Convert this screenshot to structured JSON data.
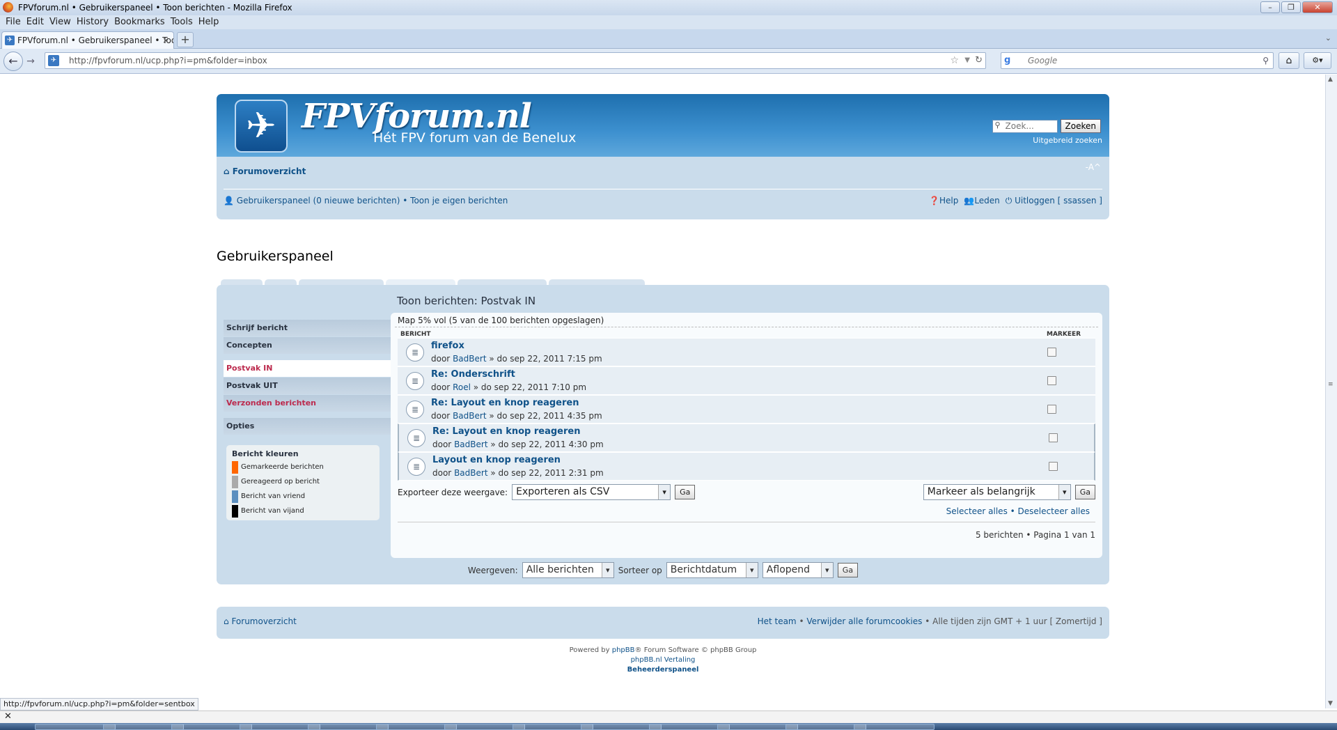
{
  "browser": {
    "window_title": "FPVforum.nl • Gebruikerspaneel • Toon berichten - Mozilla Firefox",
    "menu": [
      "File",
      "Edit",
      "View",
      "History",
      "Bookmarks",
      "Tools",
      "Help"
    ],
    "tab_title": "FPVforum.nl • Gebruikerspaneel • Toon ...",
    "url": "http://fpvforum.nl/ucp.php?i=pm&folder=inbox",
    "search_placeholder": "Google",
    "status_url": "http://fpvforum.nl/ucp.php?i=pm&folder=sentbox"
  },
  "site": {
    "title": "FPVforum.nl",
    "subtitle": "Hét FPV forum van de Benelux",
    "search_placeholder": "Zoek...",
    "search_button": "Zoeken",
    "advanced_search": "Uitgebreid zoeken",
    "font_size_toggle": "-A^",
    "breadcrumb": "Forumoverzicht",
    "user_panel_link": "Gebruikerspaneel (0 nieuwe berichten)",
    "own_posts_link": "• Toon je eigen berichten",
    "help": "Help",
    "members": "Leden",
    "logout": "Uitloggen [ ssassen ]"
  },
  "ucp": {
    "title": "Gebruikerspaneel",
    "heading": "Toon berichten: Postvak IN",
    "menu": [
      {
        "label": "Schrijf bericht",
        "state": "normal"
      },
      {
        "label": "Concepten",
        "state": "normal"
      },
      {
        "label": "Postvak IN",
        "state": "active"
      },
      {
        "label": "Postvak UIT",
        "state": "normal"
      },
      {
        "label": "Verzonden berichten",
        "state": "highlight"
      },
      {
        "label": "Opties",
        "state": "normal"
      }
    ],
    "legend_title": "Bericht kleuren",
    "legend": [
      {
        "label": "Gemarkeerde berichten",
        "color": "#ff6600"
      },
      {
        "label": "Gereageerd op bericht",
        "color": "#aaaaaa"
      },
      {
        "label": "Bericht van vriend",
        "color": "#5c8fbf"
      },
      {
        "label": "Bericht van vijand",
        "color": "#000000"
      }
    ],
    "quota": "Map 5% vol (5 van de 100 berichten opgeslagen)",
    "col_message": "BERICHT",
    "col_mark": "MARKEER",
    "messages": [
      {
        "title": "firefox",
        "by": "door",
        "author": "BadBert",
        "date": "» do sep 22, 2011 7:15 pm",
        "marked": false
      },
      {
        "title": "Re: Onderschrift",
        "by": "door",
        "author": "Roel",
        "date": "» do sep 22, 2011 7:10 pm",
        "marked": false
      },
      {
        "title": "Re: Layout en knop reageren",
        "by": "door",
        "author": "BadBert",
        "date": "» do sep 22, 2011 4:35 pm",
        "marked": false
      },
      {
        "title": "Re: Layout en knop reageren",
        "by": "door",
        "author": "BadBert",
        "date": "» do sep 22, 2011 4:30 pm",
        "marked": true
      },
      {
        "title": "Layout en knop reageren",
        "by": "door",
        "author": "BadBert",
        "date": "» do sep 22, 2011 2:31 pm",
        "marked": true
      }
    ],
    "export_label": "Exporteer deze weergave:",
    "export_value": "Exporteren als CSV",
    "go": "Ga",
    "mark_value": "Markeer als belangrijk",
    "select_all": "Selecteer alles",
    "deselect_all": "Deselecteer alles",
    "pagination": "5 berichten • Pagina 1 van 1",
    "show_label": "Weergeven:",
    "show_value": "Alle berichten",
    "sort_label": "Sorteer op",
    "sort_value": "Berichtdatum",
    "order_value": "Aflopend"
  },
  "footer": {
    "crumb": "Forumoverzicht",
    "team": "Het team",
    "cookies": "Verwijder alle forumcookies",
    "tz": "• Alle tijden zijn GMT + 1 uur [ Zomertijd ]",
    "powered": "Powered by",
    "phpbb": "phpBB",
    "powered_rest": "® Forum Software © phpBB Group",
    "translation": "phpBB.nl Vertaling",
    "admin": "Beheerderspaneel"
  }
}
